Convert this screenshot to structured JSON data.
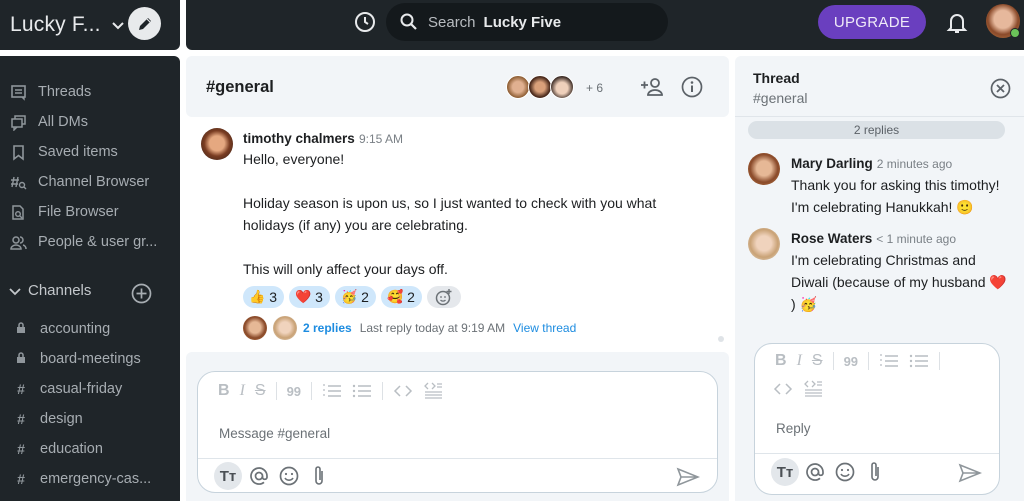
{
  "topbar": {
    "workspace_name": "Lucky F...",
    "search_label": "Search",
    "search_scope": "Lucky Five",
    "upgrade_label": "UPGRADE",
    "colors": {
      "bar": "#1f2529",
      "upgrade": "#6a3fbf",
      "status_online": "#6ac259"
    }
  },
  "sidebar": {
    "nav": [
      {
        "label": "Threads",
        "icon": "threads-icon"
      },
      {
        "label": "All DMs",
        "icon": "all-dms-icon"
      },
      {
        "label": "Saved items",
        "icon": "bookmark-icon"
      },
      {
        "label": "Channel Browser",
        "icon": "channel-browser-icon"
      },
      {
        "label": "File Browser",
        "icon": "file-browser-icon"
      },
      {
        "label": "People & user gr...",
        "icon": "people-icon"
      }
    ],
    "channels_header": "Channels",
    "channels": [
      {
        "name": "accounting",
        "glyph": "lock"
      },
      {
        "name": "board-meetings",
        "glyph": "lock"
      },
      {
        "name": "casual-friday",
        "glyph": "#"
      },
      {
        "name": "design",
        "glyph": "#"
      },
      {
        "name": "education",
        "glyph": "#"
      },
      {
        "name": "emergency-cas...",
        "glyph": "#"
      }
    ]
  },
  "channel": {
    "title": "#general",
    "member_more": "+ 6",
    "message": {
      "author": "timothy chalmers",
      "time": "9:15 AM",
      "lines": [
        "Hello, everyone!",
        "Holiday season is upon us, so I just wanted to check with you what",
        "holidays (if any) you are celebrating.",
        "This will only affect your days off."
      ],
      "reactions": [
        {
          "emoji": "👍",
          "count": "3"
        },
        {
          "emoji": "❤️",
          "count": "3"
        },
        {
          "emoji": "🥳",
          "count": "2"
        },
        {
          "emoji": "🥰",
          "count": "2"
        }
      ],
      "replies_count": "2 replies",
      "last_reply": "Last reply today at 9:19 AM",
      "view_thread": "View thread"
    },
    "composer_placeholder": "Message #general",
    "link_color": "#1d8ce0"
  },
  "thread": {
    "title": "Thread",
    "subtitle": "#general",
    "replies_pill": "2 replies",
    "replies": [
      {
        "author": "Mary Darling",
        "time": "2 minutes ago",
        "lines": [
          "Thank you for asking this timothy!",
          "I'm celebrating Hanukkah! 🙂"
        ]
      },
      {
        "author": "Rose Waters",
        "time": "< 1 minute ago",
        "lines": [
          "I'm celebrating Christmas and",
          "Diwali (because of my husband ❤️",
          ") 🥳"
        ]
      }
    ],
    "composer_placeholder": "Reply"
  },
  "format_bar": {
    "bold": "B",
    "italic": "I",
    "strike": "S",
    "quote": "99",
    "tt": "Tт"
  }
}
